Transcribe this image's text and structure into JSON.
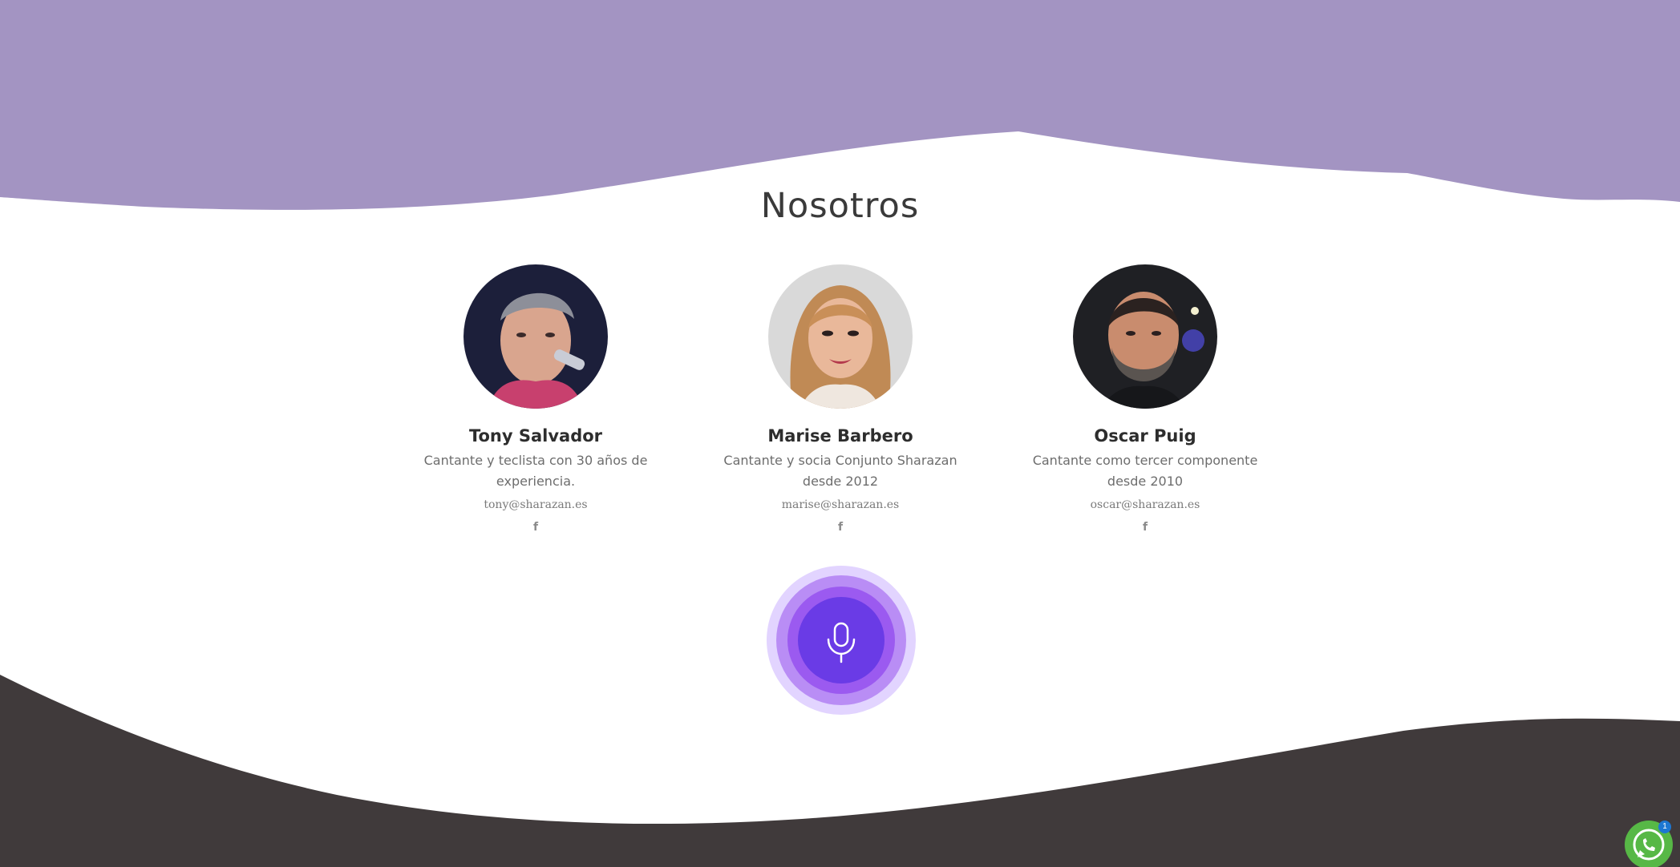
{
  "colors": {
    "top_wave": "#a394c2",
    "bottom_wave": "#403a3b",
    "mic_core": "#6a3be6",
    "mic_rings": [
      "#e2d4ff",
      "#b98df5",
      "#9b5af0"
    ],
    "whatsapp": "#57b846",
    "badge": "#1d77d2"
  },
  "section": {
    "title": "Nosotros"
  },
  "team": [
    {
      "name": "Tony Salvador",
      "description": "Cantante y teclista con 30 años de experiencia.",
      "email": "tony@sharazan.es",
      "social_icon": "facebook-icon",
      "social_glyph": "f"
    },
    {
      "name": "Marise Barbero",
      "description": "Cantante y socia Conjunto Sharazan desde 2012",
      "email": "marise@sharazan.es",
      "social_icon": "facebook-icon",
      "social_glyph": "f"
    },
    {
      "name": "Oscar Puig",
      "description": "Cantante como tercer componente desde 2010",
      "email": "oscar@sharazan.es",
      "social_icon": "facebook-icon",
      "social_glyph": "f"
    }
  ],
  "mic_button": {
    "icon": "microphone-icon"
  },
  "whatsapp": {
    "icon": "whatsapp-icon",
    "badge_count": "1"
  }
}
